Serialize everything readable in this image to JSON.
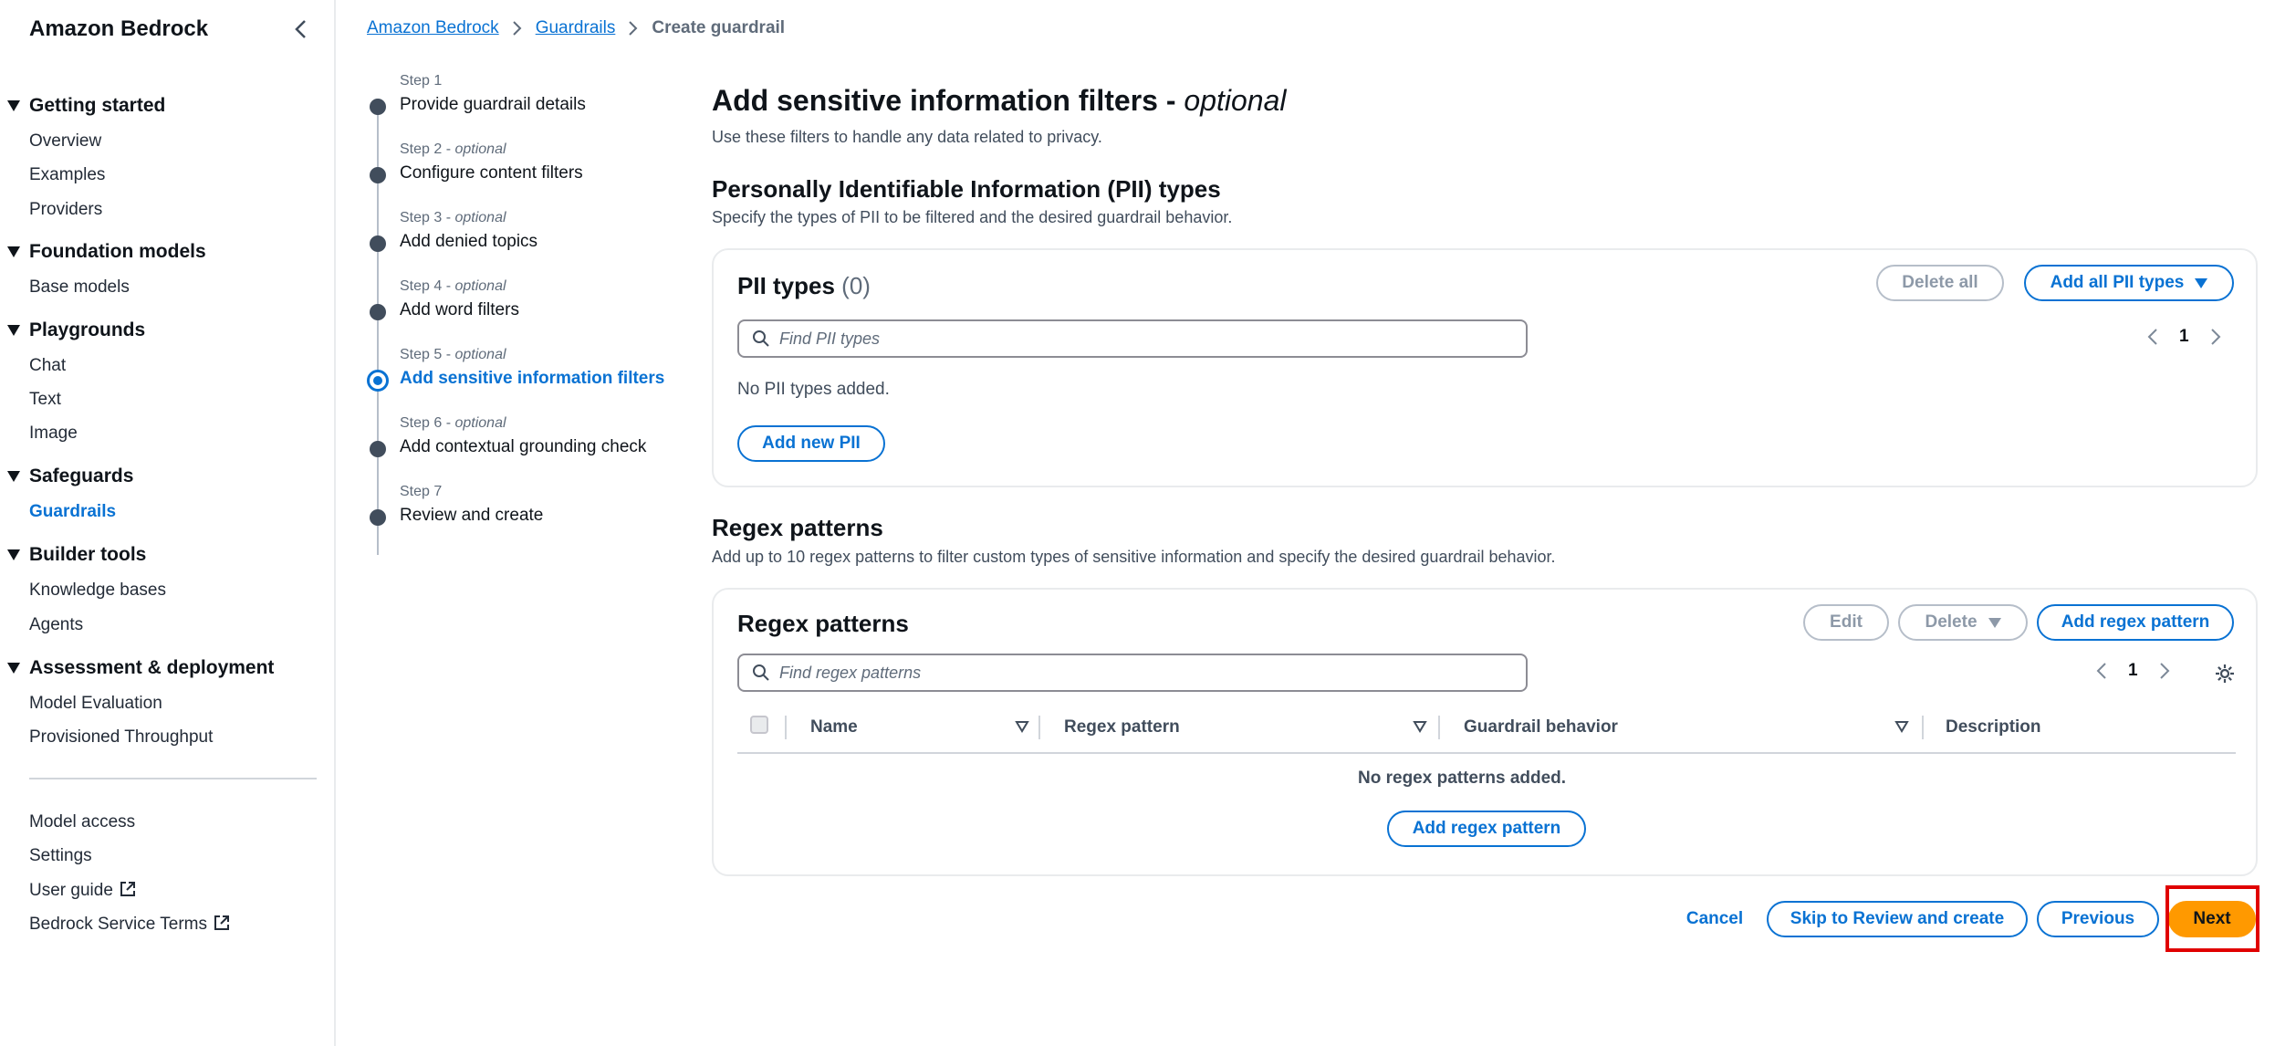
{
  "sidebar": {
    "title": "Amazon Bedrock",
    "sections": [
      {
        "label": "Getting started",
        "items": [
          "Overview",
          "Examples",
          "Providers"
        ]
      },
      {
        "label": "Foundation models",
        "items": [
          "Base models"
        ]
      },
      {
        "label": "Playgrounds",
        "items": [
          "Chat",
          "Text",
          "Image"
        ]
      },
      {
        "label": "Safeguards",
        "items": [
          "Guardrails"
        ]
      },
      {
        "label": "Builder tools",
        "items": [
          "Knowledge bases",
          "Agents"
        ]
      },
      {
        "label": "Assessment & deployment",
        "items": [
          "Model Evaluation",
          "Provisioned Throughput"
        ]
      }
    ],
    "footer_links": [
      "Model access",
      "Settings",
      "User guide",
      "Bedrock Service Terms"
    ],
    "active_item": "Guardrails"
  },
  "breadcrumb": [
    "Amazon Bedrock",
    "Guardrails",
    "Create guardrail"
  ],
  "steps": [
    {
      "label": "Step 1",
      "optional": "",
      "title": "Provide guardrail details"
    },
    {
      "label": "Step 2 - ",
      "optional": "optional",
      "title": "Configure content filters"
    },
    {
      "label": "Step 3 - ",
      "optional": "optional",
      "title": "Add denied topics"
    },
    {
      "label": "Step 4 - ",
      "optional": "optional",
      "title": "Add word filters"
    },
    {
      "label": "Step 5 - ",
      "optional": "optional",
      "title": "Add sensitive information filters"
    },
    {
      "label": "Step 6 - ",
      "optional": "optional",
      "title": "Add contextual grounding check"
    },
    {
      "label": "Step 7",
      "optional": "",
      "title": "Review and create"
    }
  ],
  "active_step": 5,
  "page": {
    "title": "Add sensitive information filters - ",
    "title_optional": "optional",
    "description": "Use these filters to handle any data related to privacy."
  },
  "pii": {
    "heading": "Personally Identifiable Information (PII) types",
    "description": "Specify the types of PII to be filtered and the desired guardrail behavior.",
    "panel_title": "PII types",
    "count": "(0)",
    "delete_all": "Delete all",
    "add_all": "Add all PII types",
    "search_placeholder": "Find PII types",
    "page_number": "1",
    "empty": "No PII types added.",
    "add_new": "Add new PII"
  },
  "regex": {
    "heading": "Regex patterns",
    "description": "Add up to 10 regex patterns to filter custom types of sensitive information and specify the desired guardrail behavior.",
    "panel_title": "Regex patterns",
    "edit": "Edit",
    "delete": "Delete",
    "add": "Add regex pattern",
    "search_placeholder": "Find regex patterns",
    "page_number": "1",
    "columns": [
      "Name",
      "Regex pattern",
      "Guardrail behavior",
      "Description"
    ],
    "empty": "No regex patterns added.",
    "add_empty": "Add regex pattern"
  },
  "footer": {
    "cancel": "Cancel",
    "skip": "Skip to Review and create",
    "previous": "Previous",
    "next": "Next"
  },
  "colors": {
    "accent": "#0972d3",
    "primary_button": "#ff9900",
    "highlight": "#e00000"
  }
}
